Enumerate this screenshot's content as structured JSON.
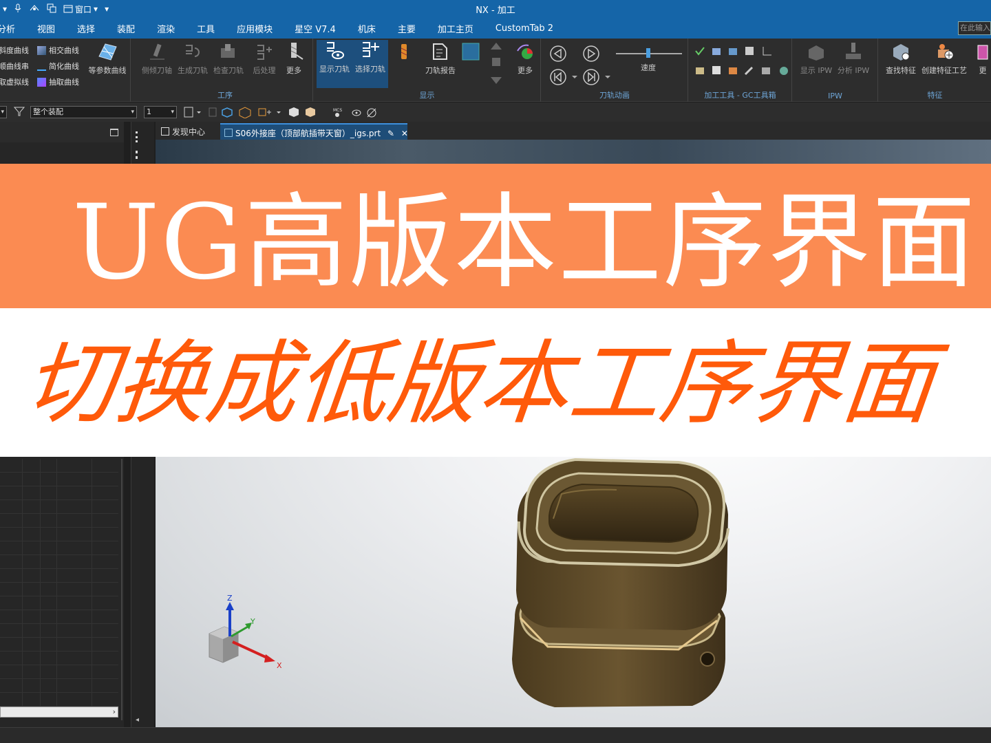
{
  "window": {
    "title": "NX - 加工",
    "quick_access_window_label": "窗口"
  },
  "menu": {
    "items": [
      "分析",
      "视图",
      "选择",
      "装配",
      "渲染",
      "工具",
      "应用模块",
      "星空 V7.4",
      "机床",
      "主要",
      "加工主页",
      "CustomTab 2"
    ],
    "search_placeholder": "在此输入"
  },
  "ribbon": {
    "curve_list": [
      "斜度曲线",
      "顺曲线串",
      "取虚拟线"
    ],
    "curve_list2": [
      "相交曲线",
      "简化曲线",
      "抽取曲线"
    ],
    "iso_curve": "等参数曲线",
    "operation_buttons": [
      "侧倾刀轴",
      "生成刀轨",
      "检查刀轨",
      "后处理",
      "更多"
    ],
    "operation_group": "工序",
    "display_buttons": [
      "显示刀轨",
      "选择刀轨",
      "刀轨报告",
      "更多"
    ],
    "display_group": "显示",
    "animation_speed_label": "速度",
    "animation_group": "刀轨动画",
    "gc_group": "加工工具 - GC工具箱",
    "ipw_buttons": [
      "显示 IPW",
      "分析 IPW"
    ],
    "ipw_group": "IPW",
    "feature_buttons": [
      "查找特征",
      "创建特征工艺",
      "更"
    ],
    "feature_group": "特征"
  },
  "selection_bar": {
    "scope_value": "整个装配",
    "layer_value": "1"
  },
  "tabs": [
    {
      "label": "发现中心",
      "active": false
    },
    {
      "label": "S06外接座（顶部航插带天窗）_igs.prt",
      "active": true
    }
  ],
  "banner": {
    "line1": "UG高版本工序界面",
    "line2": "切换成低版本工序界面"
  },
  "triad": {
    "x": "X",
    "y": "Y",
    "z": "Z"
  },
  "colors": {
    "titlebar": "#1565a8",
    "banner_orange": "#fb8b52",
    "banner_text_orange": "#ff5a0a",
    "model_bronze": "#5e4a2a"
  }
}
